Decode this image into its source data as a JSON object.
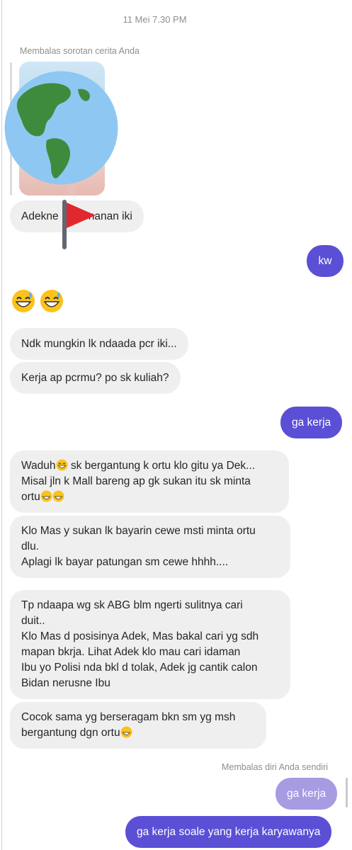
{
  "header": {
    "timestamp": "11 Mei 7.30 PM"
  },
  "story_reply": {
    "caption": "Membalas sorotan cerita Anda"
  },
  "messages": {
    "m1": "Adekne .. y tenanan iki",
    "m2": "kw",
    "m3": "Ndk mungkin lk ndaada pcr iki...",
    "m4": "Kerja ap pcrmu? po sk kuliah?",
    "m5": "ga kerja",
    "m6": {
      "l1": "Waduh",
      "l1b": " sk bergantung k ortu klo gitu ya Dek...",
      "l2": "Misal jln k Mall bareng ap gk sukan itu sk minta",
      "l3": "ortu"
    },
    "m7": {
      "l1": "Klo Mas y sukan lk bayarin cewe msti minta ortu",
      "l2": "dlu.",
      "l3": "Aplagi lk bayar patungan sm cewe hhhh...."
    },
    "m8": {
      "l1": "Tp ndaapa wg sk ABG blm ngerti sulitnya cari",
      "l2": "duit..",
      "l3": "Klo Mas d posisinya Adek, Mas bakal cari yg sdh",
      "l4": "mapan bkrja. Lihat Adek klo mau cari idaman",
      "l5": "Ibu yo Polisi nda bkl d tolak, Adek jg cantik calon",
      "l6": "Bidan nerusne Ibu"
    },
    "m9": {
      "l1": "Cocok sama yg berseragam bkn sm yg msh",
      "l2": "bergantung dgn ortu"
    },
    "self_reply_caption": "Membalas diri Anda sendiri",
    "quoted": "ga kerja",
    "m10": "ga kerja soale yang kerja karyawanya"
  },
  "colors": {
    "outgoing": "#5b4fd6",
    "outgoing_quoted": "#a79be2",
    "incoming": "#efefef"
  },
  "icons": [
    "globe-americas-emoji",
    "red-flag-emoji",
    "grinning-sweat-emoji"
  ]
}
